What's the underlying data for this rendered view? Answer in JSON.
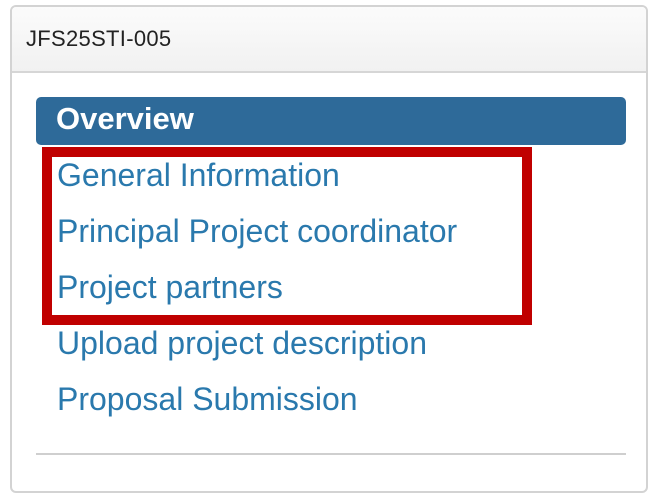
{
  "panel": {
    "title": "JFS25STI-005"
  },
  "nav": {
    "active_label": "Overview",
    "items": [
      {
        "label": "General Information"
      },
      {
        "label": "Principal Project coordinator"
      },
      {
        "label": "Project partners"
      },
      {
        "label": "Upload project description"
      },
      {
        "label": "Proposal Submission"
      }
    ]
  },
  "colors": {
    "active_background": "#2e6a99",
    "link": "#2a79ad",
    "highlight_border": "#c00000"
  }
}
